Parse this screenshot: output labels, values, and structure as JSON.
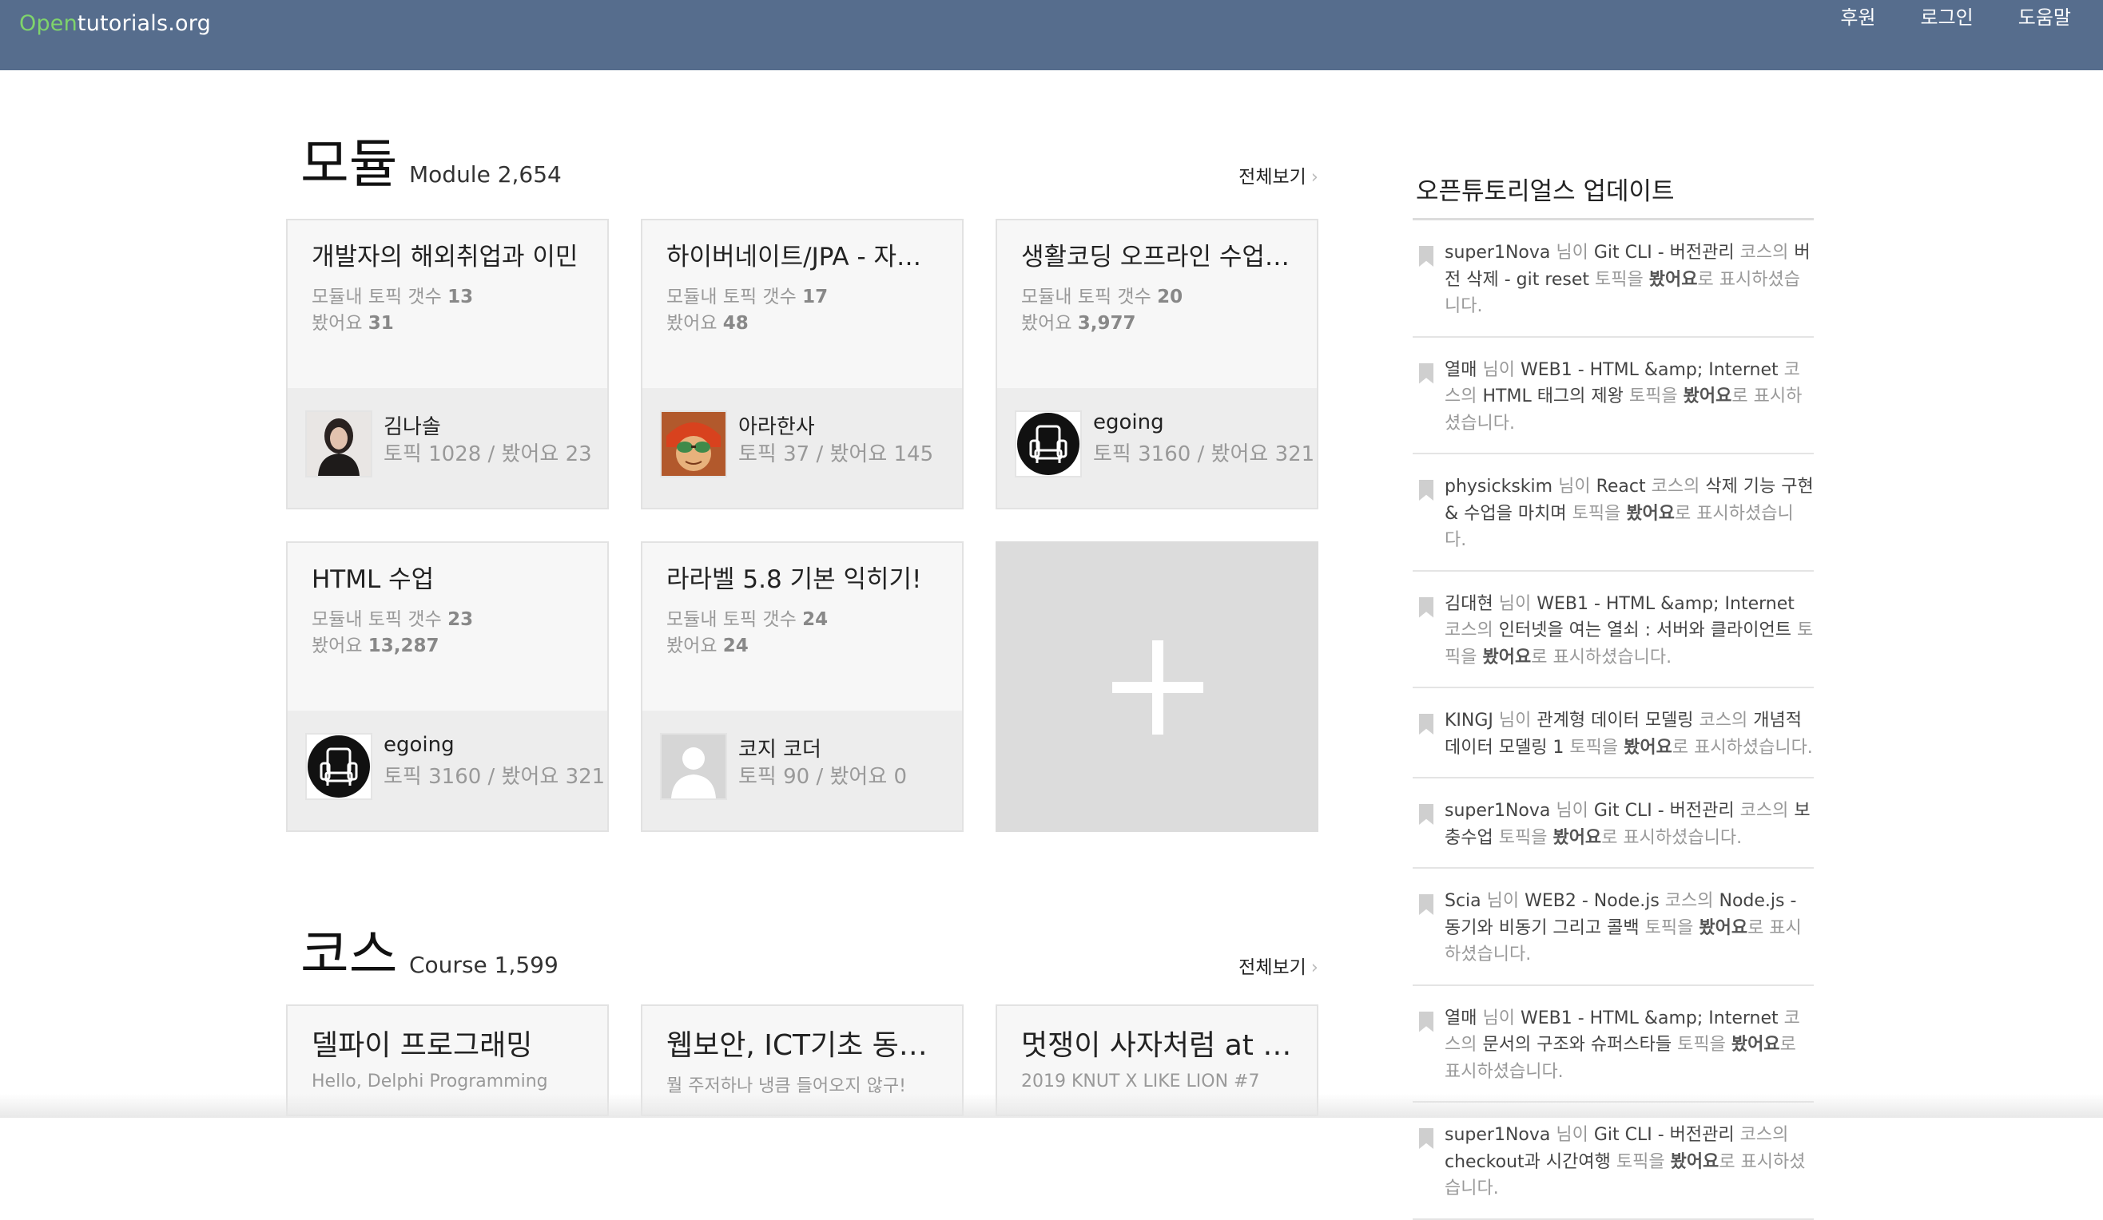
{
  "header": {
    "logo_open": "Open",
    "logo_rest": "tutorials.org",
    "nav": [
      "후원",
      "로그인",
      "도움말"
    ]
  },
  "modules": {
    "title": "모듈",
    "subtitle": "Module 2,654",
    "see_all": "전체보기",
    "chevron": "›",
    "topic_label": "모듈내 토픽 갯수",
    "seen_label": "봤어요",
    "cards": [
      {
        "title": "개발자의 해외취업과 이민",
        "topics": "13",
        "seen": "31",
        "author": "김나솔",
        "author_stats": "토픽 1028 / 봤어요 23",
        "avatar": "person-photo"
      },
      {
        "title": "하이버네이트/JPA - 자바…",
        "topics": "17",
        "seen": "48",
        "author": "아라한사",
        "author_stats": "토픽 37 / 봤어요 145",
        "avatar": "cartoon"
      },
      {
        "title": "생활코딩 오프라인 수업 …",
        "topics": "20",
        "seen": "3,977",
        "author": "egoing",
        "author_stats": "토픽 3160 / 봤어요 321",
        "avatar": "chair"
      },
      {
        "title": "HTML 수업",
        "topics": "23",
        "seen": "13,287",
        "author": "egoing",
        "author_stats": "토픽 3160 / 봤어요 321",
        "avatar": "chair"
      },
      {
        "title": "라라벨 5.8 기본 익히기!",
        "topics": "24",
        "seen": "24",
        "author": "코지 코더",
        "author_stats": "토픽 90 / 봤어요 0",
        "avatar": "default-user"
      }
    ]
  },
  "courses": {
    "title": "코스",
    "subtitle": "Course 1,599",
    "see_all": "전체보기",
    "chevron": "›",
    "cards": [
      {
        "title": "델파이 프로그래밍",
        "desc": "Hello, Delphi Programming"
      },
      {
        "title": "웹보안, ICT기초 동…",
        "desc": "뭘 주저하나 냉큼 들어오지 않구!"
      },
      {
        "title": "멋쟁이 사자처럼 at …",
        "desc": "2019 KNUT X LIKE LION #7"
      }
    ]
  },
  "sidebar": {
    "title": "오픈튜토리얼스 업데이트",
    "updates": [
      {
        "user": "super1Nova",
        "t1": " 님이 ",
        "course": "Git CLI - 버전관리",
        "t2": " 코스의 ",
        "topic": "버전 삭제 - git reset",
        "t3": " 토픽을 ",
        "action": "봤어요",
        "t4": "로 표시하셨습니다."
      },
      {
        "user": "열매",
        "t1": " 님이 ",
        "course": "WEB1 - HTML &amp; Internet",
        "t2": " 코스의 ",
        "topic": "HTML 태그의 제왕",
        "t3": " 토픽을 ",
        "action": "봤어요",
        "t4": "로 표시하셨습니다."
      },
      {
        "user": "physickskim",
        "t1": " 님이 ",
        "course": "React",
        "t2": " 코스의 ",
        "topic": "삭제 기능 구현 & 수업을 마치며",
        "t3": " 토픽을 ",
        "action": "봤어요",
        "t4": "로 표시하셨습니다."
      },
      {
        "user": "김대현",
        "t1": " 님이 ",
        "course": "WEB1 - HTML &amp; Internet",
        "t2": " 코스의 ",
        "topic": "인터넷을 여는 열쇠 : 서버와 클라이언트",
        "t3": " 토픽을 ",
        "action": "봤어요",
        "t4": "로 표시하셨습니다."
      },
      {
        "user": "KINGJ",
        "t1": " 님이 ",
        "course": "관계형 데이터 모델링",
        "t2": " 코스의 ",
        "topic": "개념적 데이터 모델링 1",
        "t3": " 토픽을 ",
        "action": "봤어요",
        "t4": "로 표시하셨습니다."
      },
      {
        "user": "super1Nova",
        "t1": " 님이 ",
        "course": "Git CLI - 버전관리",
        "t2": " 코스의 ",
        "topic": "보충수업",
        "t3": " 토픽을 ",
        "action": "봤어요",
        "t4": "로 표시하셨습니다."
      },
      {
        "user": "Scia",
        "t1": " 님이 ",
        "course": "WEB2 - Node.js",
        "t2": " 코스의 ",
        "topic": "Node.js - 동기와 비동기 그리고 콜백",
        "t3": " 토픽을 ",
        "action": "봤어요",
        "t4": "로 표시하셨습니다."
      },
      {
        "user": "열매",
        "t1": " 님이 ",
        "course": "WEB1 - HTML &amp; Internet",
        "t2": " 코스의 ",
        "topic": "문서의 구조와 슈퍼스타들",
        "t3": " 토픽을 ",
        "action": "봤어요",
        "t4": "로 표시하셨습니다."
      },
      {
        "user": "super1Nova",
        "t1": " 님이 ",
        "course": "Git CLI - 버전관리",
        "t2": " 코스의 ",
        "topic": "checkout과 시간여행",
        "t3": " 토픽을 ",
        "action": "봤어요",
        "t4": "로 표시하셨습니다."
      }
    ]
  }
}
